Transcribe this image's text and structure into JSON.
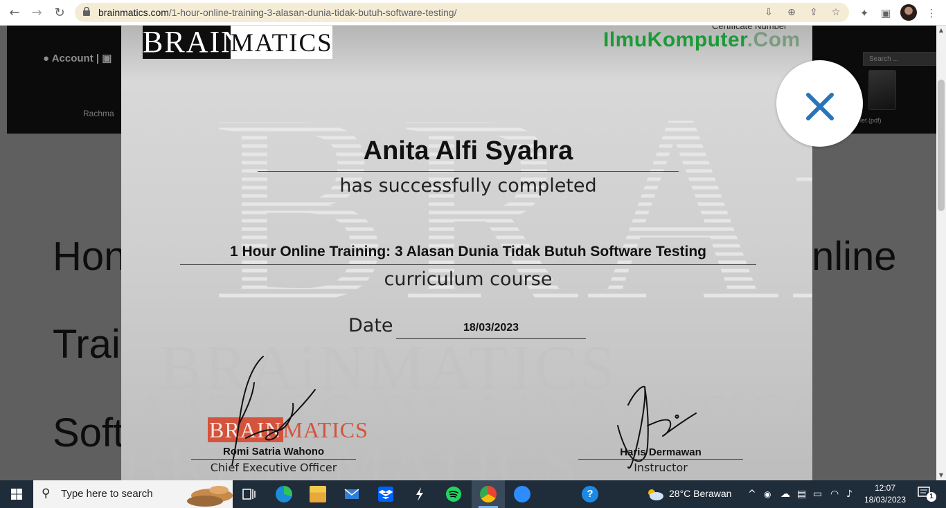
{
  "browser": {
    "url_domain": "brainmatics.com",
    "url_path": "/1-hour-online-training-3-alasan-dunia-tidak-butuh-software-testing/",
    "icons": [
      "back-icon",
      "forward-icon",
      "reload-icon",
      "lock-icon",
      "install-icon",
      "zoom-icon",
      "share-icon",
      "bookmark-star-icon",
      "extensions-icon",
      "side-panel-icon",
      "profile-avatar",
      "menu-icon"
    ]
  },
  "site": {
    "account_label": "Account",
    "user_name": "Rachma",
    "search_placeholder": "Search ...",
    "tablet_label": "let (pdf)",
    "title_fragments": [
      "Hon",
      "nline",
      "Trai",
      "Soft"
    ]
  },
  "certificate": {
    "logo_left": "BRAIN",
    "logo_right": "MATICS",
    "certificate_number_label": "Certificate Number",
    "partner_name": "IlmuKomputer",
    "partner_suffix": ".Com",
    "recipient": "Anita Alfi Syahra",
    "completed_text": "has successfully completed",
    "course_title": "1 Hour Online Training: 3 Alasan Dunia Tidak Butuh Software Testing",
    "curriculum_text": "curriculum course",
    "date_label": "Date",
    "date_value": "18/03/2023",
    "small_logo_left": "BRAIN",
    "small_logo_right": "MATICS",
    "signer1_name": "Romi Satria Wahono",
    "signer1_title": "Chief Executive Officer",
    "signer2_name": "Haris Dermawan",
    "signer2_title": "Instructor",
    "watermark_text": "BRAINMATICS"
  },
  "modal": {
    "close_icon": "close-x-icon",
    "accent": "#2a75b8"
  },
  "taskbar": {
    "search_placeholder": "Type here to search",
    "apps": [
      "task-view-icon",
      "edge-icon",
      "file-explorer-icon",
      "mail-icon",
      "dropbox-icon",
      "app-icon",
      "spotify-icon",
      "chrome-icon",
      "zoom-icon",
      "help-icon"
    ],
    "weather": "28°C  Berawan",
    "time": "12:07",
    "date": "18/03/2023",
    "notification_count": "1"
  },
  "colors": {
    "partner_green": "#1c9a38",
    "brainmatics_red": "#d4533d",
    "omnibox_bg": "#f5ecd6",
    "taskbar_bg": "#1f2c3a"
  }
}
